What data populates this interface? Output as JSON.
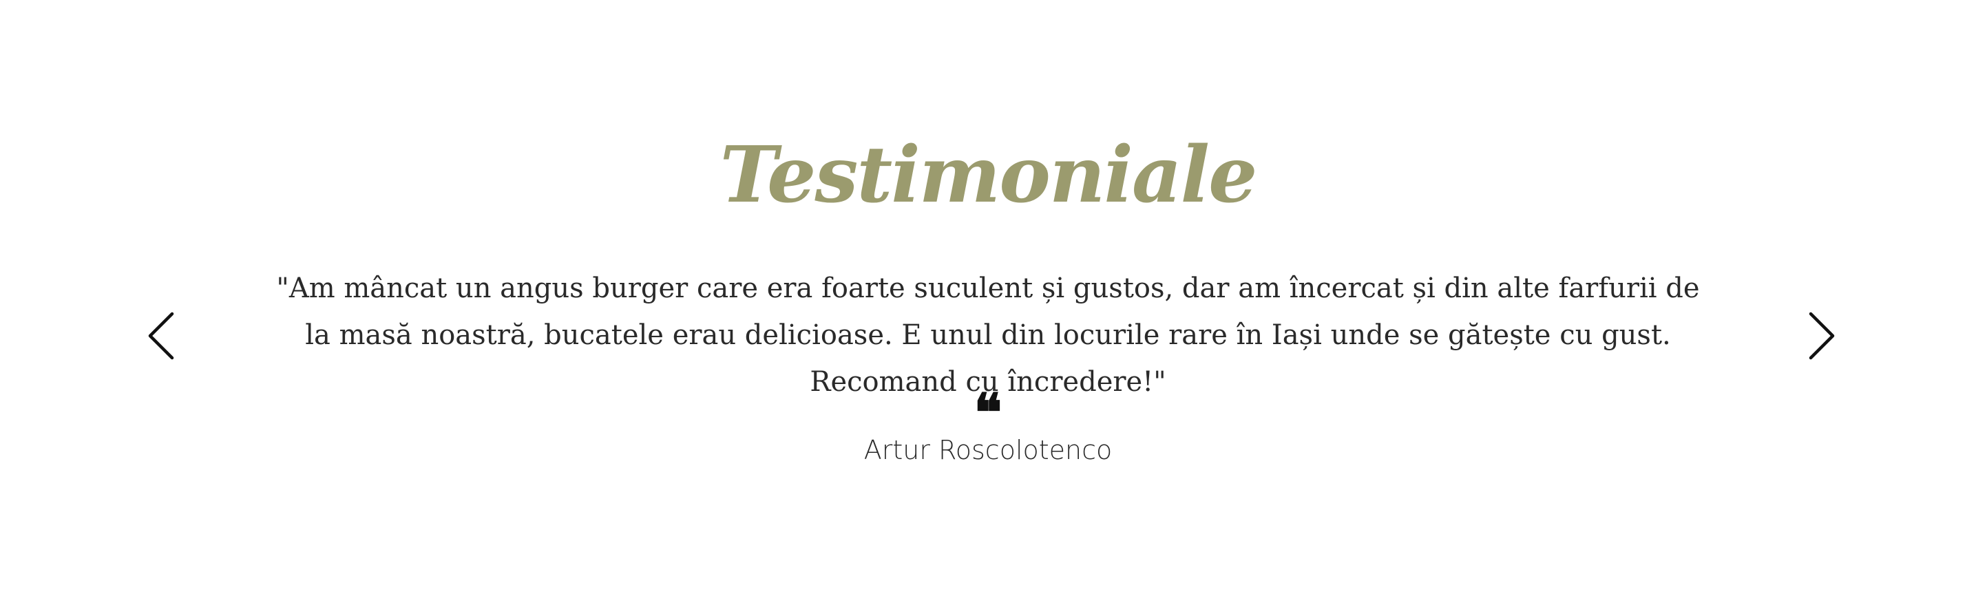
{
  "colors": {
    "title": "#9b9b6e",
    "text": "#2a2a2a",
    "arrow": "#111111"
  },
  "testimonials": {
    "title": "Testimoniale",
    "quote": "\"Am mâncat un angus burger care era foarte suculent și gustos, dar am încercat și din alte farfurii de la masă noastră, bucatele erau delicioase. E unul din locurile rare în Iași unde se gătește cu gust. Recomand cu încredere!\"",
    "quote_icon": "quote-icon",
    "quote_glyph": "❝",
    "author": "Artur Roscolotenco",
    "prev_icon": "chevron-left-icon",
    "next_icon": "chevron-right-icon"
  }
}
